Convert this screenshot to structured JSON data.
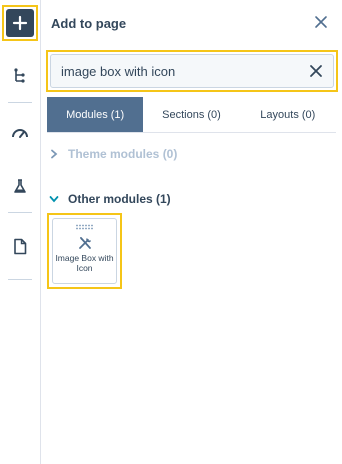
{
  "panel": {
    "title": "Add to page"
  },
  "search": {
    "value": "image box with icon"
  },
  "tabs": [
    {
      "label": "Modules (1)",
      "active": true
    },
    {
      "label": "Sections (0)",
      "active": false
    },
    {
      "label": "Layouts (0)",
      "active": false
    }
  ],
  "sections": {
    "theme": {
      "label": "Theme modules (0)",
      "expanded": false
    },
    "other": {
      "label": "Other modules (1)",
      "expanded": true
    }
  },
  "modules": [
    {
      "label": "Image Box with Icon",
      "icon": "tools-icon"
    }
  ],
  "rail": {
    "icons": [
      "add-icon",
      "tree-icon",
      "gauge-icon",
      "flask-icon",
      "page-icon"
    ]
  },
  "colors": {
    "highlight": "#f5c518",
    "active_tab": "#516f90",
    "text": "#33475b",
    "muted": "#b0c1d4"
  }
}
